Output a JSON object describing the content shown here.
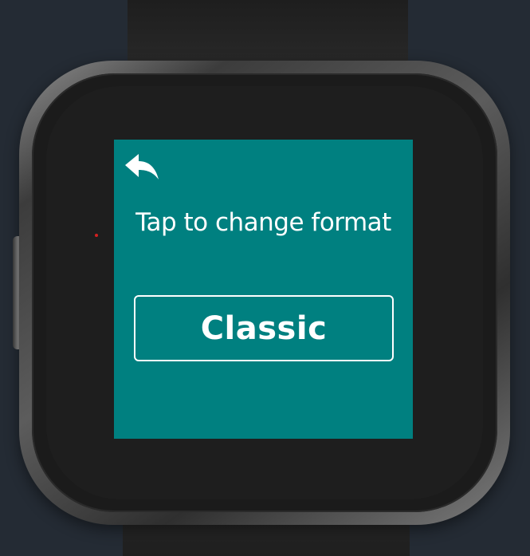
{
  "screen": {
    "background_color": "#008080",
    "back_button": {
      "icon": "reply-arrow-icon"
    },
    "prompt_text": "Tap to change format",
    "format_button": {
      "label": "Classic"
    }
  },
  "device": {
    "indicator_color": "#d42020"
  }
}
